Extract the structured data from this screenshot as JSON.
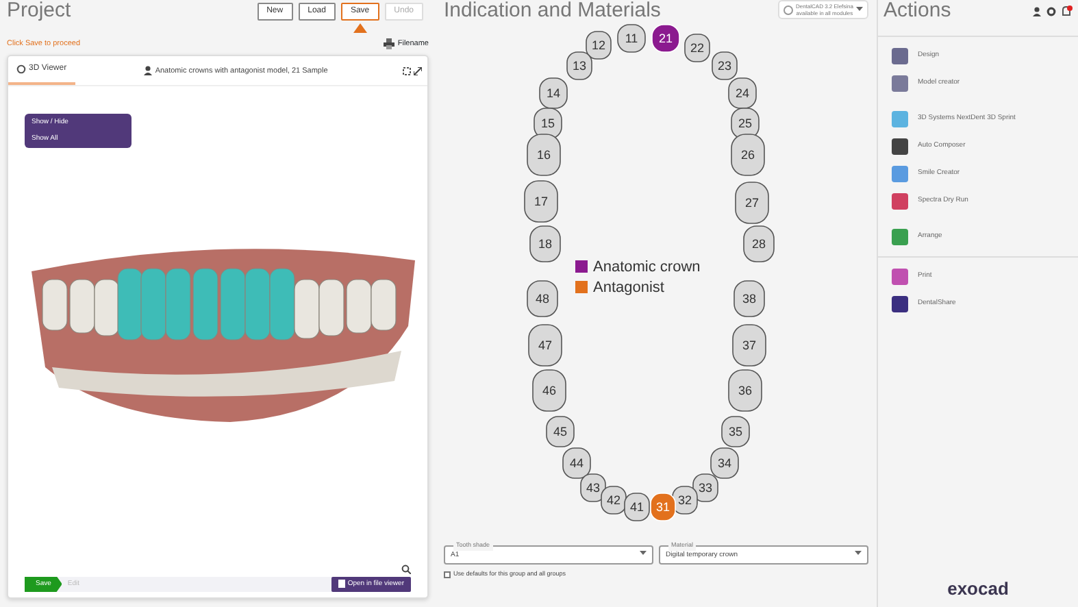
{
  "project": {
    "title": "Project",
    "toolbar": [
      {
        "label": "New",
        "selected": false,
        "disabled": false
      },
      {
        "label": "Load",
        "selected": false,
        "disabled": false
      },
      {
        "label": "Save",
        "selected": true,
        "disabled": false
      },
      {
        "label": "Undo",
        "selected": false,
        "disabled": true
      }
    ],
    "hint": "Click Save to proceed",
    "filename_button": "Filename",
    "viewer": {
      "tab": {
        "label": "3D Viewer",
        "selected": true
      },
      "case_title": "Anatomic crowns with antagonist model, 21 Sample",
      "overlay": [
        "Show / Hide",
        "Show All"
      ],
      "status": {
        "step": "Save",
        "note": "Edit",
        "open_button": "Open in file viewer"
      }
    }
  },
  "indication": {
    "title": "Indication and Materials",
    "version": [
      "DentalCAD 3.2 Elefsina",
      "available in all modules"
    ],
    "legend": [
      {
        "kind": "crown",
        "label": "Anatomic crown",
        "color": "#8b1a8f"
      },
      {
        "kind": "antagonist",
        "label": "Antagonist",
        "color": "#e2711d"
      }
    ],
    "teeth": [
      {
        "number": "11",
        "kind": "plain"
      },
      {
        "number": "21",
        "kind": "crown"
      },
      {
        "number": "12",
        "kind": "plain"
      },
      {
        "number": "22",
        "kind": "plain"
      },
      {
        "number": "13",
        "kind": "plain"
      },
      {
        "number": "23",
        "kind": "plain"
      },
      {
        "number": "14",
        "kind": "plain"
      },
      {
        "number": "24",
        "kind": "plain"
      },
      {
        "number": "15",
        "kind": "plain"
      },
      {
        "number": "25",
        "kind": "plain"
      },
      {
        "number": "16",
        "kind": "plain"
      },
      {
        "number": "26",
        "kind": "plain"
      },
      {
        "number": "17",
        "kind": "plain"
      },
      {
        "number": "27",
        "kind": "plain"
      },
      {
        "number": "18",
        "kind": "plain"
      },
      {
        "number": "28",
        "kind": "plain"
      },
      {
        "number": "48",
        "kind": "plain"
      },
      {
        "number": "38",
        "kind": "plain"
      },
      {
        "number": "47",
        "kind": "plain"
      },
      {
        "number": "37",
        "kind": "plain"
      },
      {
        "number": "46",
        "kind": "plain"
      },
      {
        "number": "36",
        "kind": "plain"
      },
      {
        "number": "45",
        "kind": "plain"
      },
      {
        "number": "35",
        "kind": "plain"
      },
      {
        "number": "44",
        "kind": "plain"
      },
      {
        "number": "34",
        "kind": "plain"
      },
      {
        "number": "43",
        "kind": "plain"
      },
      {
        "number": "33",
        "kind": "plain"
      },
      {
        "number": "42",
        "kind": "plain"
      },
      {
        "number": "32",
        "kind": "plain"
      },
      {
        "number": "41",
        "kind": "plain"
      },
      {
        "number": "31",
        "kind": "antagonist"
      }
    ],
    "fields": [
      {
        "label": "Tooth shade",
        "value": "A1"
      },
      {
        "label": "Material",
        "value": "Digital temporary crown"
      }
    ],
    "checkbox": {
      "label": "Use defaults for this group and all groups",
      "checked": false
    }
  },
  "actions": {
    "title": "Actions",
    "notification": true,
    "sections": [
      [
        "Design",
        "Model creator",
        "3D Systems NextDent 3D Sprint",
        "Auto Composer",
        "Smile Creator",
        "Spectra Dry Run",
        "Arrange"
      ],
      [
        "Print",
        "DentalShare"
      ]
    ],
    "logo": "exocad"
  }
}
